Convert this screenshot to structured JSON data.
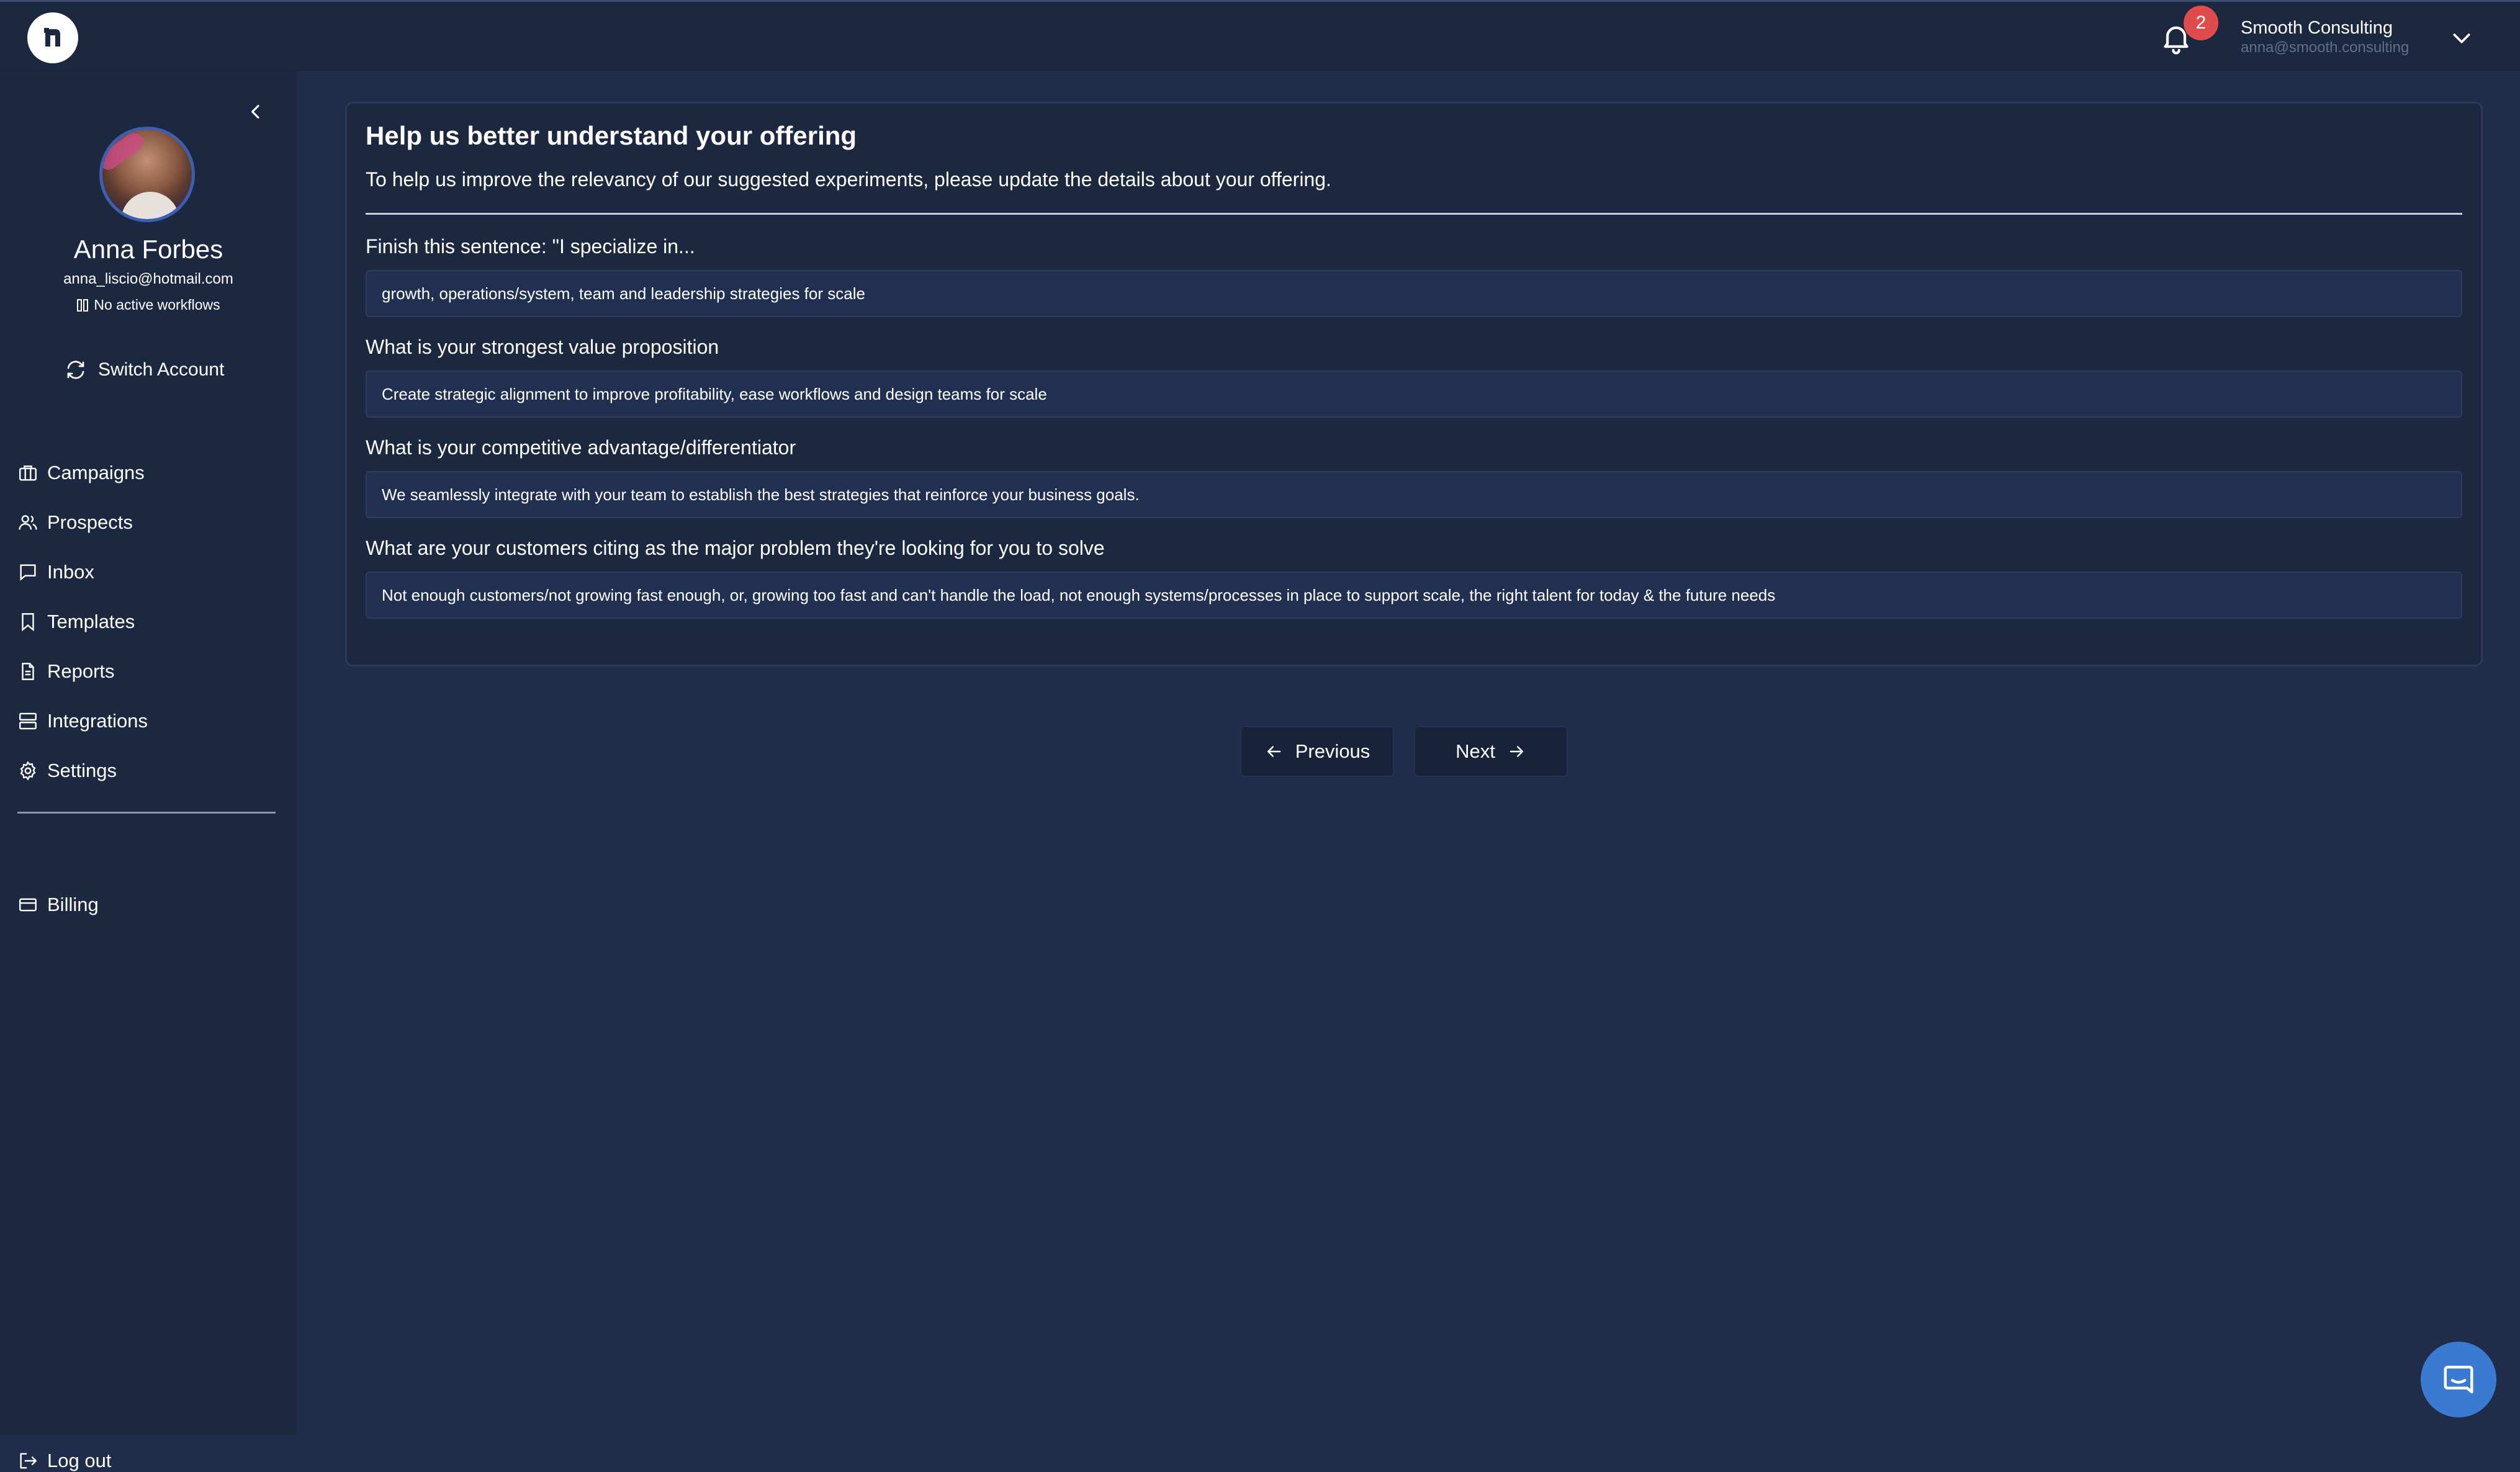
{
  "header": {
    "notification_count": "2",
    "account_name": "Smooth Consulting",
    "account_email": "anna@smooth.consulting"
  },
  "sidebar": {
    "profile": {
      "name": "Anna Forbes",
      "email": "anna_liscio@hotmail.com",
      "workflow_status": "No active workflows"
    },
    "switch_account_label": "Switch Account",
    "nav": [
      {
        "label": "Campaigns",
        "icon": "briefcase-icon"
      },
      {
        "label": "Prospects",
        "icon": "users-icon"
      },
      {
        "label": "Inbox",
        "icon": "message-icon"
      },
      {
        "label": "Templates",
        "icon": "bookmark-icon"
      },
      {
        "label": "Reports",
        "icon": "document-icon"
      },
      {
        "label": "Integrations",
        "icon": "server-icon"
      },
      {
        "label": "Settings",
        "icon": "gear-icon"
      }
    ],
    "billing_label": "Billing",
    "logout_label": "Log out"
  },
  "form": {
    "title": "Help us better understand your offering",
    "subtitle": "To help us improve the relevancy of our suggested experiments, please update the details about your offering.",
    "questions": [
      {
        "label": "Finish this sentence: \"I specialize in...",
        "value": "growth, operations/system, team and leadership strategies for scale"
      },
      {
        "label": "What is your strongest value proposition",
        "value": "Create strategic alignment to improve profitability, ease workflows and design teams for scale"
      },
      {
        "label": "What is your competitive advantage/differentiator",
        "value": "We seamlessly integrate with your team to establish the best strategies that reinforce your business goals."
      },
      {
        "label": "What are your customers citing as the major problem they're looking for you to solve",
        "value": "Not enough customers/not growing fast enough, or, growing too fast and can't handle the load, not enough systems/processes in place to support scale, the right talent for today & the future needs"
      }
    ]
  },
  "pager": {
    "previous_label": "Previous",
    "next_label": "Next"
  }
}
